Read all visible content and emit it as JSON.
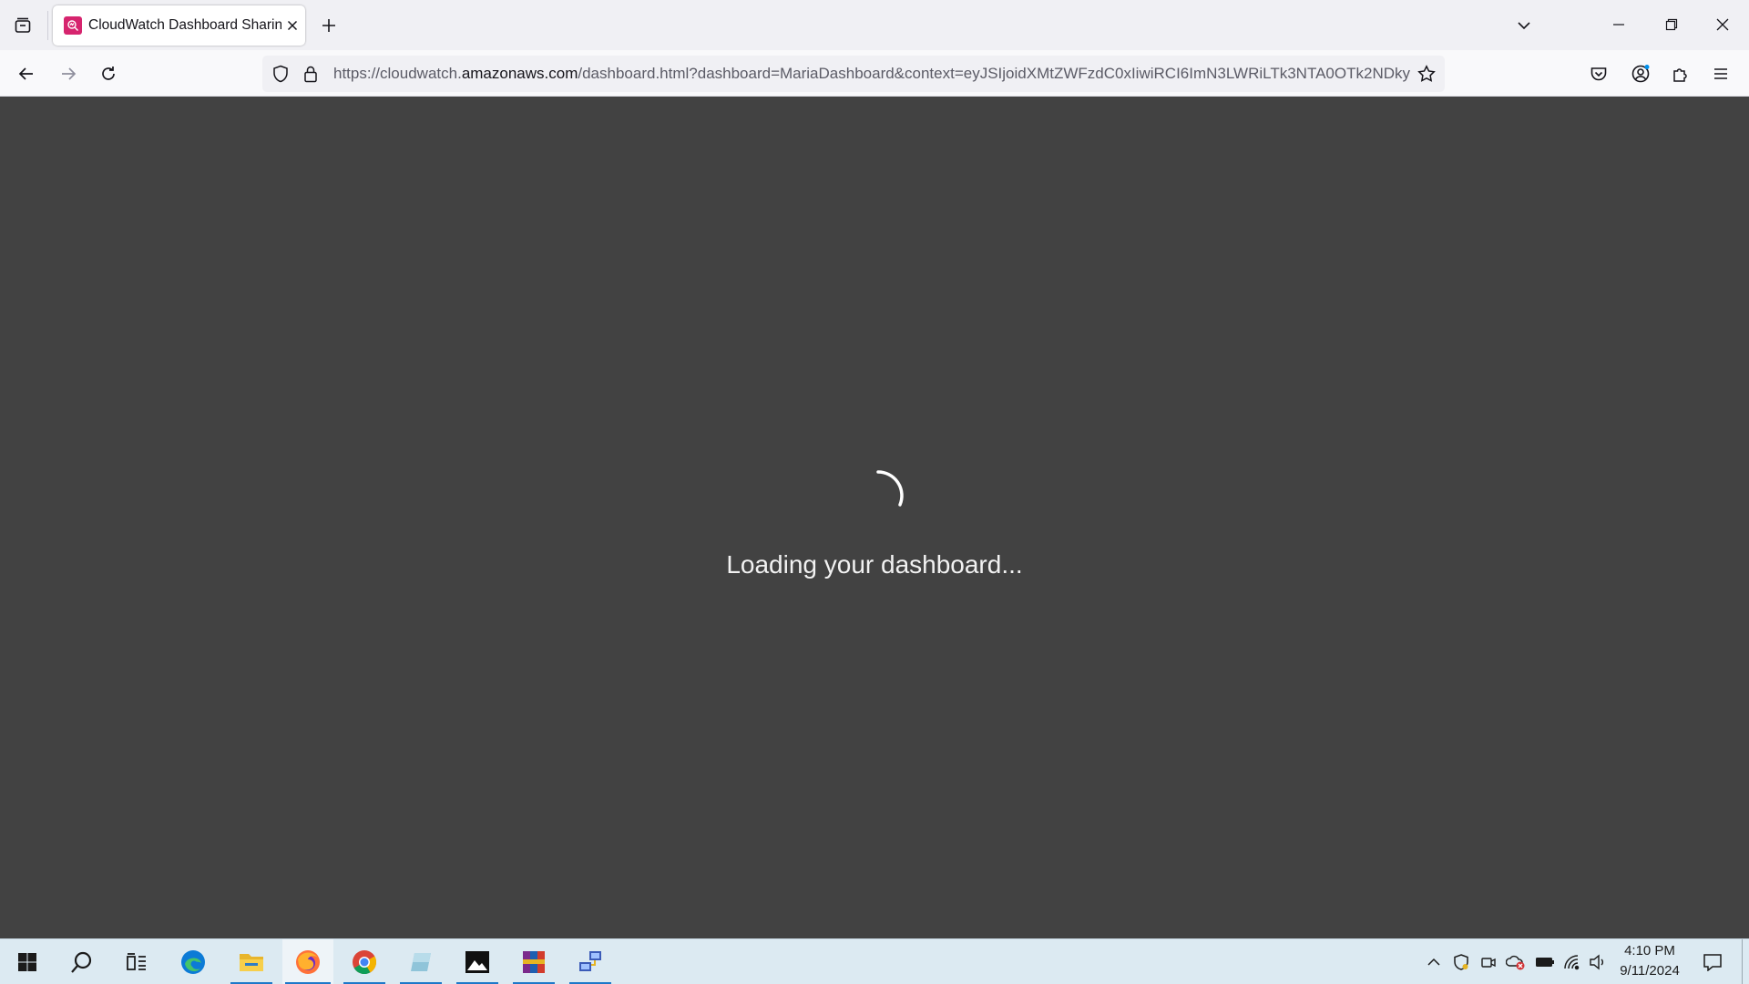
{
  "browser": {
    "tab": {
      "title": "CloudWatch Dashboard Sharing",
      "favicon": "cloudwatch-icon"
    },
    "url": {
      "prefix": "https://cloudwatch.",
      "domain": "amazonaws.com",
      "path": "/dashboard.html?dashboard=MariaDashboard&context=eyJSIjoidXMtZWFzdC0xIiwiRCI6ImN3LWRiLTk3NTA0OTk2NDky"
    },
    "icons": {
      "tab_list": "tab-list-icon",
      "new_tab": "plus-icon",
      "tab_overflow": "chevron-down-icon",
      "back": "back-arrow-icon",
      "forward": "forward-arrow-icon",
      "reload": "reload-icon",
      "shield": "tracking-protection-shield-icon",
      "lock": "lock-icon",
      "bookmark": "star-icon",
      "pocket": "pocket-icon",
      "account": "account-icon",
      "extensions": "puzzle-icon",
      "menu": "hamburger-menu-icon"
    }
  },
  "page": {
    "loading_text": "Loading your dashboard...",
    "background": "#424242"
  },
  "taskbar": {
    "apps": [
      "start",
      "search",
      "task-view",
      "edge",
      "file-explorer",
      "firefox",
      "chrome",
      "notepad-app",
      "photos",
      "winrar",
      "network-app"
    ],
    "time": "4:10 PM",
    "date": "9/11/2024"
  },
  "colors": {
    "accent": "#1d78c9",
    "favicon": "#d6246e"
  }
}
